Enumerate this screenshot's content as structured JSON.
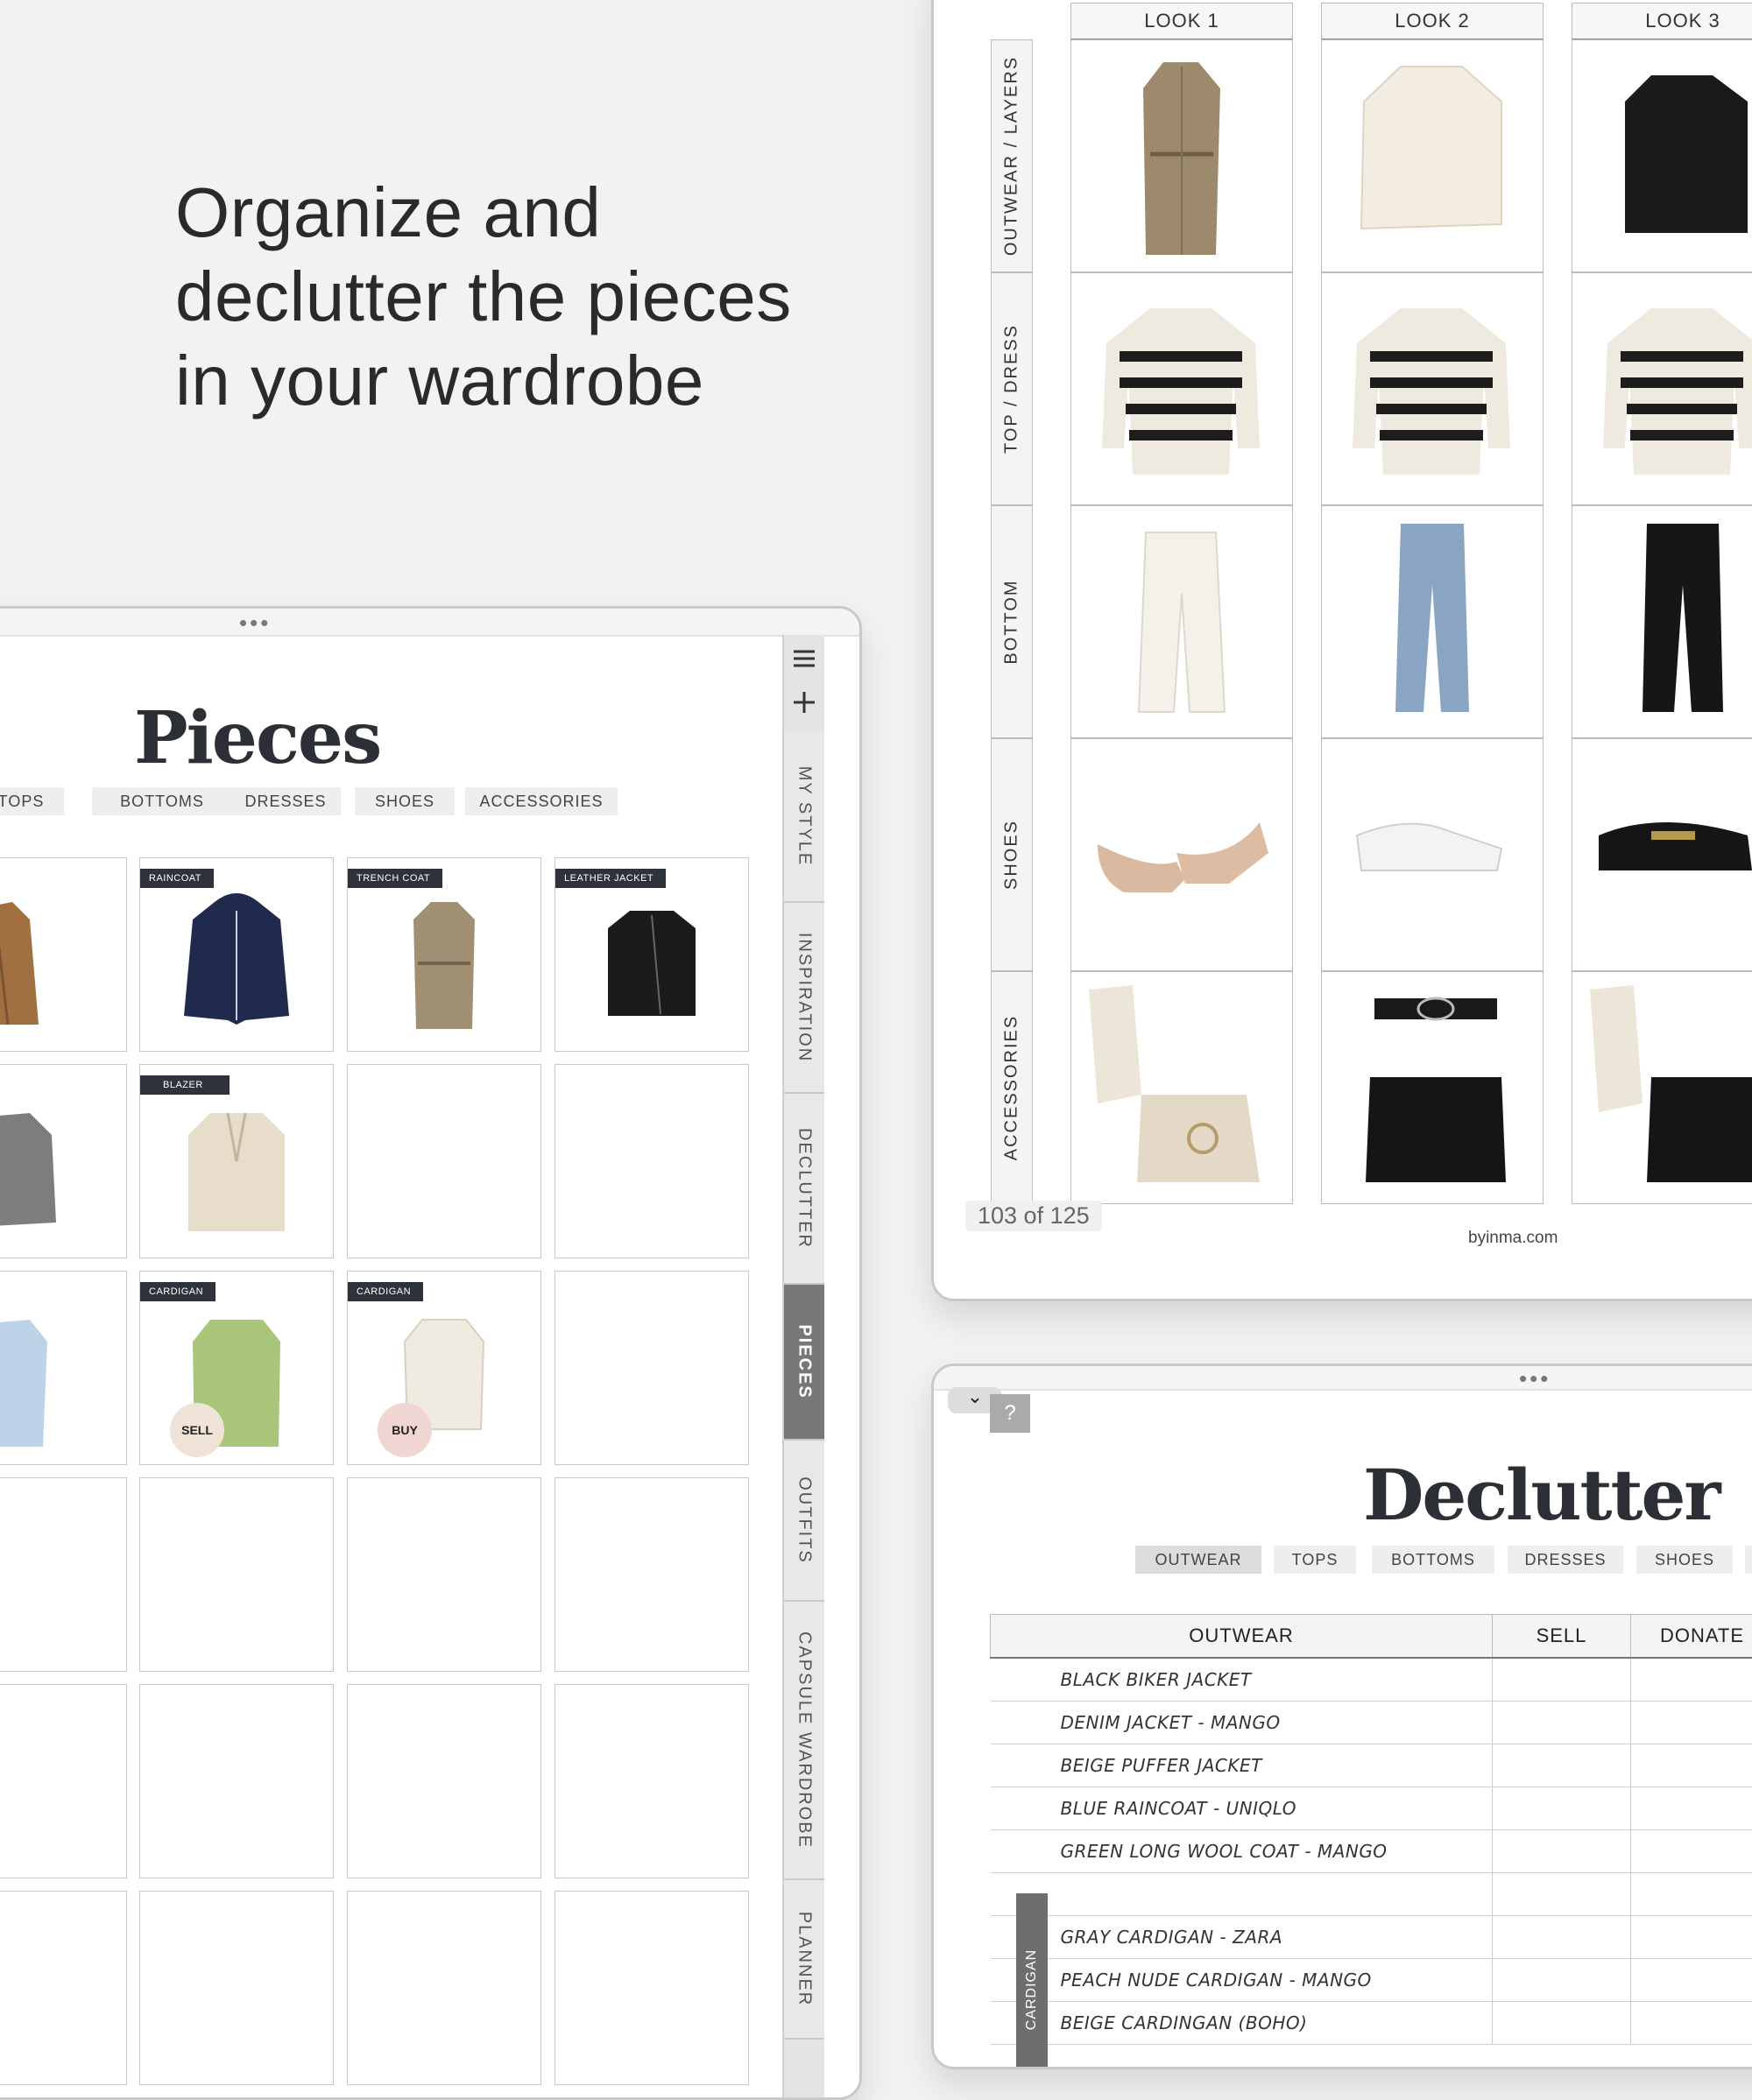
{
  "headline": {
    "line1": "Organize and",
    "line2": "declutter the pieces",
    "line3": "in your wardrobe"
  },
  "pieces": {
    "title": "Pieces",
    "categories": [
      "TOPS",
      "BOTTOMS",
      "DRESSES",
      "SHOES",
      "ACCESSORIES"
    ],
    "items": {
      "raincoat": "RAINCOAT",
      "trench": "TRENCH COAT",
      "leather": "LEATHER JACKET",
      "blazer": "BLAZER",
      "cardigan1": "CARDIGAN",
      "cardigan2": "CARDIGAN"
    },
    "badges": {
      "sell": "SELL",
      "buy": "BUY"
    },
    "side_tabs": [
      "MY STYLE",
      "INSPIRATION",
      "DECLUTTER",
      "PIECES",
      "OUTFITS",
      "CAPSULE WARDROBE",
      "PLANNER"
    ],
    "active_tab": "PIECES"
  },
  "capsule": {
    "looks": [
      "LOOK 1",
      "LOOK 2",
      "LOOK 3"
    ],
    "rows": [
      "OUTWEAR / LAYERS",
      "TOP / DRESS",
      "BOTTOM",
      "SHOES",
      "ACCESSORIES"
    ],
    "page": "103 of 125",
    "site": "byinma.com"
  },
  "declutter": {
    "title": "Declutter",
    "help": "?",
    "collapse": "⌄",
    "tabs": [
      "OUTWEAR",
      "TOPS",
      "BOTTOMS",
      "DRESSES",
      "SHOES"
    ],
    "active_tab": "OUTWEAR",
    "columns": [
      "OUTWEAR",
      "SELL",
      "DONATE"
    ],
    "rows": [
      "BLACK BIKER JACKET",
      "DENIM JACKET - MANGO",
      "BEIGE PUFFER JACKET",
      "BLUE RAINCOAT - UNIQLO",
      "GREEN LONG WOOL COAT - MANGO",
      "",
      "GRAY CARDIGAN - ZARA",
      "PEACH NUDE CARDIGAN - MANGO",
      "BEIGE CARDINGAN (BOHO)"
    ],
    "section_label": "CARDIGAN"
  },
  "colors": {
    "dark_label": "#2e323a",
    "sell_badge": "#efe3d8",
    "buy_badge": "#f1d5d2",
    "active_side_tab": "#777777"
  }
}
